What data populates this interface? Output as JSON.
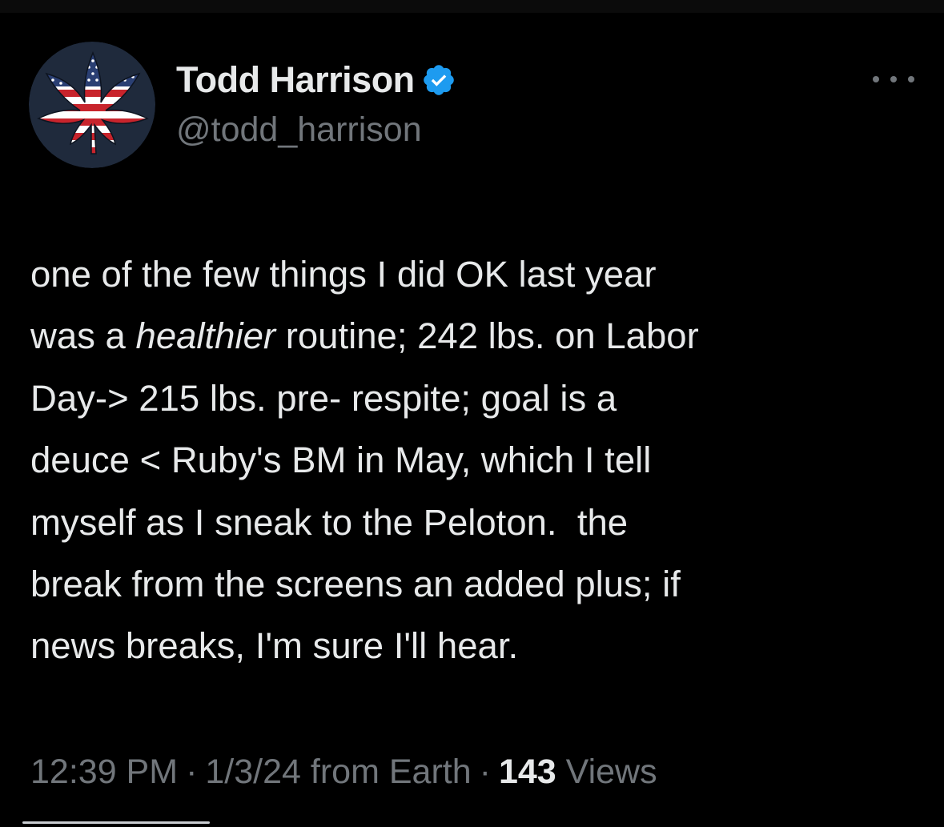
{
  "author": {
    "display_name": "Todd Harrison",
    "handle": "@todd_harrison",
    "verified": true,
    "avatar_icon": "cannabis-leaf-us-flag-icon"
  },
  "tweet": {
    "lines": [
      [
        {
          "text": "one of the few things I did OK last year"
        }
      ],
      [
        {
          "text": "was a "
        },
        {
          "text": "healthier",
          "italic": true
        },
        {
          "text": " routine; 242 lbs. on Labor"
        }
      ],
      [
        {
          "text": "Day-> 215 lbs. pre- respite; goal is a"
        }
      ],
      [
        {
          "text": "deuce < Ruby's BM in May, which I tell"
        }
      ],
      [
        {
          "text": "myself as I sneak to the Peloton.  the"
        }
      ],
      [
        {
          "text": "break from the screens an added plus; if"
        }
      ],
      [
        {
          "text": "news breaks, I'm sure I'll hear."
        }
      ]
    ]
  },
  "meta": {
    "time": "12:39 PM",
    "separator": "·",
    "date": "1/3/24",
    "source": "from Earth",
    "views_count": "143",
    "views_label": "Views"
  },
  "colors": {
    "background": "#000000",
    "text": "#e7e9ea",
    "secondary": "#71767b",
    "verified_badge": "#1d9bf0"
  }
}
